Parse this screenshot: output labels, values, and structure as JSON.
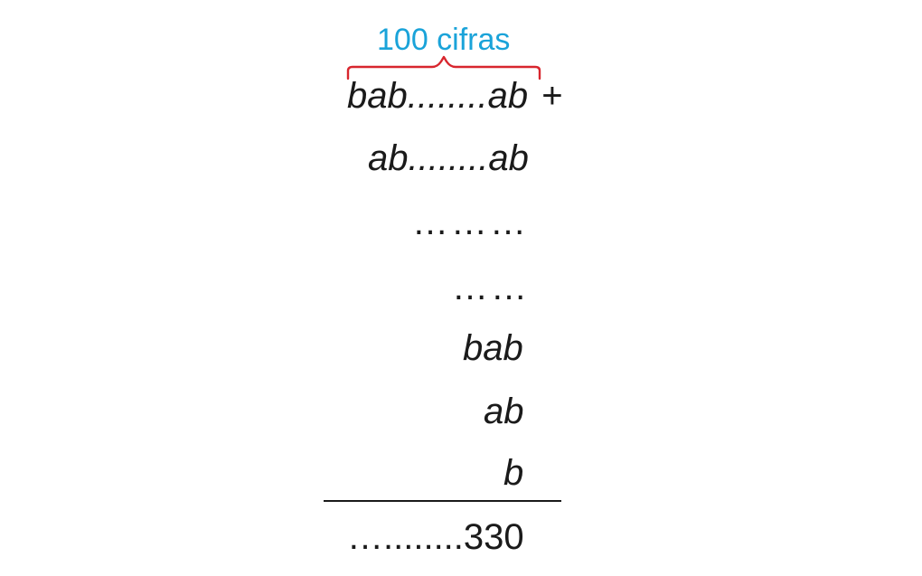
{
  "annotation": {
    "label": "100 cifras",
    "color": "#1aa3d9"
  },
  "brace_color": "#d8262e",
  "rows": [
    {
      "text": "bab........ab",
      "operator": "+"
    },
    {
      "text": "ab........ab"
    },
    {
      "text": "………"
    },
    {
      "text": "……"
    },
    {
      "text": "bab"
    },
    {
      "text": "ab"
    },
    {
      "text": "b"
    }
  ],
  "result": "…........330",
  "line_color": "#1a1a1a"
}
